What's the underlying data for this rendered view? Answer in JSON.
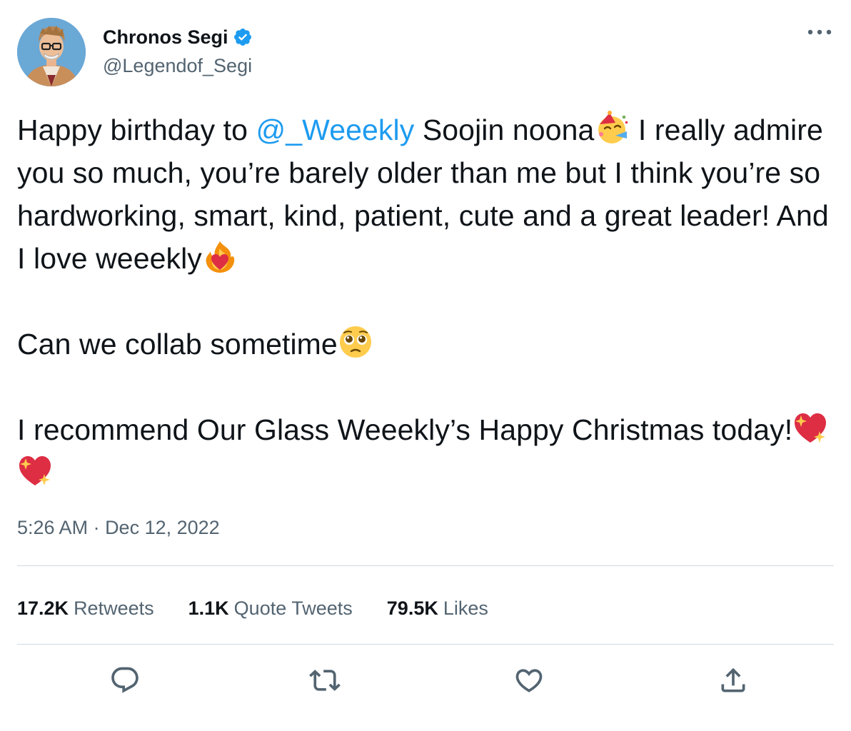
{
  "author": {
    "display_name": "Chronos Segi",
    "handle": "@Legendof_Segi",
    "verified": true,
    "avatar_icon": "illustrated-avatar-glasses"
  },
  "tweet": {
    "line1_prefix": "Happy birthday to ",
    "mention": "@_Weeekly",
    "line1_suffix": " Soojin noona",
    "emoji_party": "partying-face-emoji",
    "p1_rest": " I really admire you so much, you’re barely older than me but I think you’re so hardworking, smart, kind, patient, cute and a great leader! And I love weeekly",
    "emoji_heart_fire": "heart-on-fire-emoji",
    "p2": "Can we collab sometime",
    "emoji_pleading": "pleading-face-emoji",
    "p3": "I recommend Our Glass Weeekly’s Happy Christmas today!",
    "emoji_sparkling_heart": "sparkling-heart-emoji"
  },
  "timestamp": {
    "time": "5:26 AM",
    "separator": " · ",
    "date": "Dec 12, 2022"
  },
  "stats": {
    "retweets_count": "17.2K",
    "retweets_label": "Retweets",
    "quotes_count": "1.1K",
    "quotes_label": "Quote Tweets",
    "likes_count": "79.5K",
    "likes_label": "Likes"
  },
  "actions": [
    "reply-icon",
    "retweet-icon",
    "like-icon",
    "share-icon"
  ],
  "colors": {
    "text": "#0f1419",
    "secondary": "#536471",
    "link": "#1d9bf0",
    "divider": "#cfd9de",
    "verified": "#1d9bf0"
  }
}
